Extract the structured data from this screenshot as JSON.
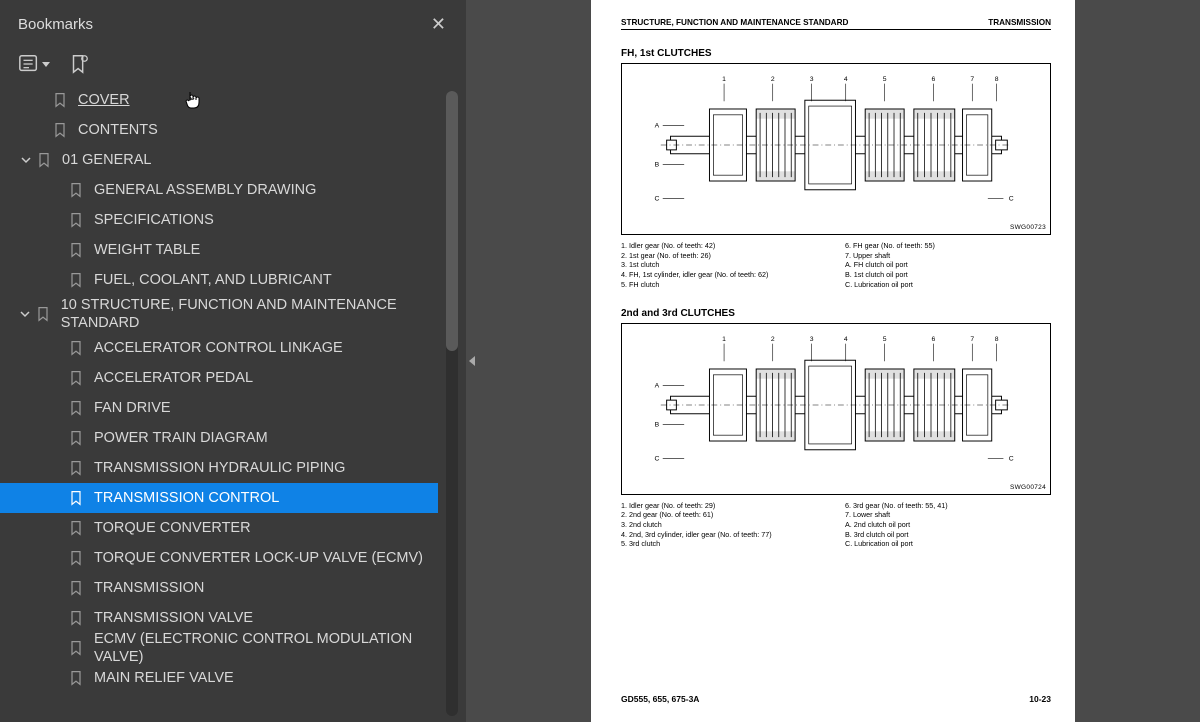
{
  "sidebar": {
    "title": "Bookmarks",
    "close_label": "✕",
    "items": [
      {
        "type": "leaf",
        "indent": 1,
        "label": "COVER",
        "underline": true
      },
      {
        "type": "leaf",
        "indent": 1,
        "label": "CONTENTS"
      },
      {
        "type": "branch",
        "indent": 0,
        "expanded": true,
        "label": "01 GENERAL"
      },
      {
        "type": "leaf",
        "indent": 2,
        "label": "GENERAL ASSEMBLY DRAWING"
      },
      {
        "type": "leaf",
        "indent": 2,
        "label": "SPECIFICATIONS"
      },
      {
        "type": "leaf",
        "indent": 2,
        "label": "WEIGHT TABLE"
      },
      {
        "type": "leaf",
        "indent": 2,
        "label": "FUEL, COOLANT, AND LUBRICANT"
      },
      {
        "type": "branch",
        "indent": 0,
        "expanded": true,
        "tall": true,
        "label": "10 STRUCTURE, FUNCTION AND MAINTENANCE STANDARD"
      },
      {
        "type": "leaf",
        "indent": 2,
        "label": "ACCELERATOR CONTROL LINKAGE"
      },
      {
        "type": "leaf",
        "indent": 2,
        "label": "ACCELERATOR PEDAL"
      },
      {
        "type": "leaf",
        "indent": 2,
        "label": "FAN DRIVE"
      },
      {
        "type": "leaf",
        "indent": 2,
        "label": "POWER TRAIN DIAGRAM"
      },
      {
        "type": "leaf",
        "indent": 2,
        "label": "TRANSMISSION HYDRAULIC PIPING"
      },
      {
        "type": "leaf",
        "indent": 2,
        "selected": true,
        "label": "TRANSMISSION CONTROL"
      },
      {
        "type": "leaf",
        "indent": 2,
        "label": "TORQUE CONVERTER"
      },
      {
        "type": "leaf",
        "indent": 2,
        "label": "TORQUE CONVERTER LOCK-UP VALVE (ECMV)"
      },
      {
        "type": "leaf",
        "indent": 2,
        "label": "TRANSMISSION"
      },
      {
        "type": "leaf",
        "indent": 2,
        "label": "TRANSMISSION VALVE"
      },
      {
        "type": "leaf",
        "indent": 2,
        "label": "ECMV (ELECTRONIC CONTROL MODULATION VALVE)"
      },
      {
        "type": "leaf",
        "indent": 2,
        "label": "MAIN RELIEF VALVE"
      }
    ]
  },
  "page": {
    "header_left": "STRUCTURE, FUNCTION AND MAINTENANCE STANDARD",
    "header_right": "TRANSMISSION",
    "section1_title": "FH, 1st CLUTCHES",
    "fig1_id": "SWG00723",
    "section1_legend_left": [
      "1. Idler gear (No. of teeth: 42)",
      "2. 1st gear (No. of teeth: 26)",
      "3. 1st clutch",
      "4. FH, 1st cylinder, idler gear (No. of teeth: 62)",
      "5. FH clutch"
    ],
    "section1_legend_right": [
      "6. FH gear (No. of teeth: 55)",
      "7. Upper shaft",
      "A. FH clutch oil port",
      "B. 1st clutch oil port",
      "C. Lubrication oil port"
    ],
    "section2_title": "2nd and 3rd CLUTCHES",
    "fig2_id": "SWG00724",
    "section2_legend_left": [
      "1. Idler gear (No. of teeth: 29)",
      "2. 2nd gear (No. of teeth: 61)",
      "3. 2nd clutch",
      "4. 2nd, 3rd cylinder, idler gear (No. of teeth: 77)",
      "5. 3rd clutch"
    ],
    "section2_legend_right": [
      "6. 3rd gear (No. of teeth: 55, 41)",
      "7. Lower shaft",
      "A. 2nd clutch oil port",
      "B. 3rd clutch oil port",
      "C. Lubrication oil port"
    ],
    "footer_left": "GD555, 655, 675-3A",
    "footer_right": "10-23",
    "callouts_top": [
      "1",
      "2",
      "3",
      "4",
      "5",
      "6",
      "7",
      "8"
    ],
    "callouts_side": [
      "A",
      "B",
      "C"
    ]
  }
}
